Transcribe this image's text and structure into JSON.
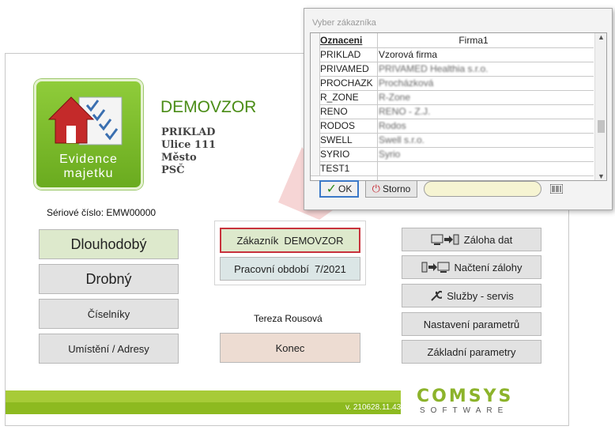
{
  "logo": {
    "line1": "Evidence",
    "line2": "majetku"
  },
  "company": {
    "name": "DEMOVZOR",
    "address": [
      "PRIKLAD",
      "Ulice 111",
      "Město",
      "PSČ"
    ]
  },
  "serial_label": "Sériové číslo: EMW00000",
  "left_buttons": [
    "Dlouhodobý",
    "Drobný",
    "Číselníky",
    "Umístění / Adresy"
  ],
  "center": {
    "customer_button": "Zákazník  DEMOVZOR",
    "period_button": "Pracovní období  7/2021",
    "user": "Tereza Rousová",
    "exit_button": "Konec"
  },
  "right_buttons": {
    "backup": "Záloha dat",
    "restore": "Načtení zálohy",
    "services": "Služby - servis",
    "settings": "Nastavení parametrů",
    "basic": "Základní parametry"
  },
  "version": "v. 210628.11.43",
  "brand": {
    "top": "COMSYS",
    "bottom": "SOFTWARE"
  },
  "dialog": {
    "title": "Vyber zákazníka",
    "columns": [
      "Oznaceni",
      "Firma1"
    ],
    "rows": [
      [
        "PRIKLAD",
        "Vzorová firma"
      ],
      [
        "PRIVAMED",
        "PRIVAMED Healthia s.r.o."
      ],
      [
        "PROCHAZK",
        "Procházková"
      ],
      [
        "R_ZONE",
        "R-Zone"
      ],
      [
        "RENO",
        "RENO - Z.J."
      ],
      [
        "RODOS",
        "Rodos"
      ],
      [
        "SWELL",
        "Swell s.r.o."
      ],
      [
        "SYRIO",
        "Syrio"
      ],
      [
        "TEST1",
        ""
      ]
    ],
    "ok": "OK",
    "storno": "Storno",
    "search_value": ""
  },
  "colors": {
    "accent_green": "#4a8c16",
    "highlight_red": "#c8323c"
  }
}
